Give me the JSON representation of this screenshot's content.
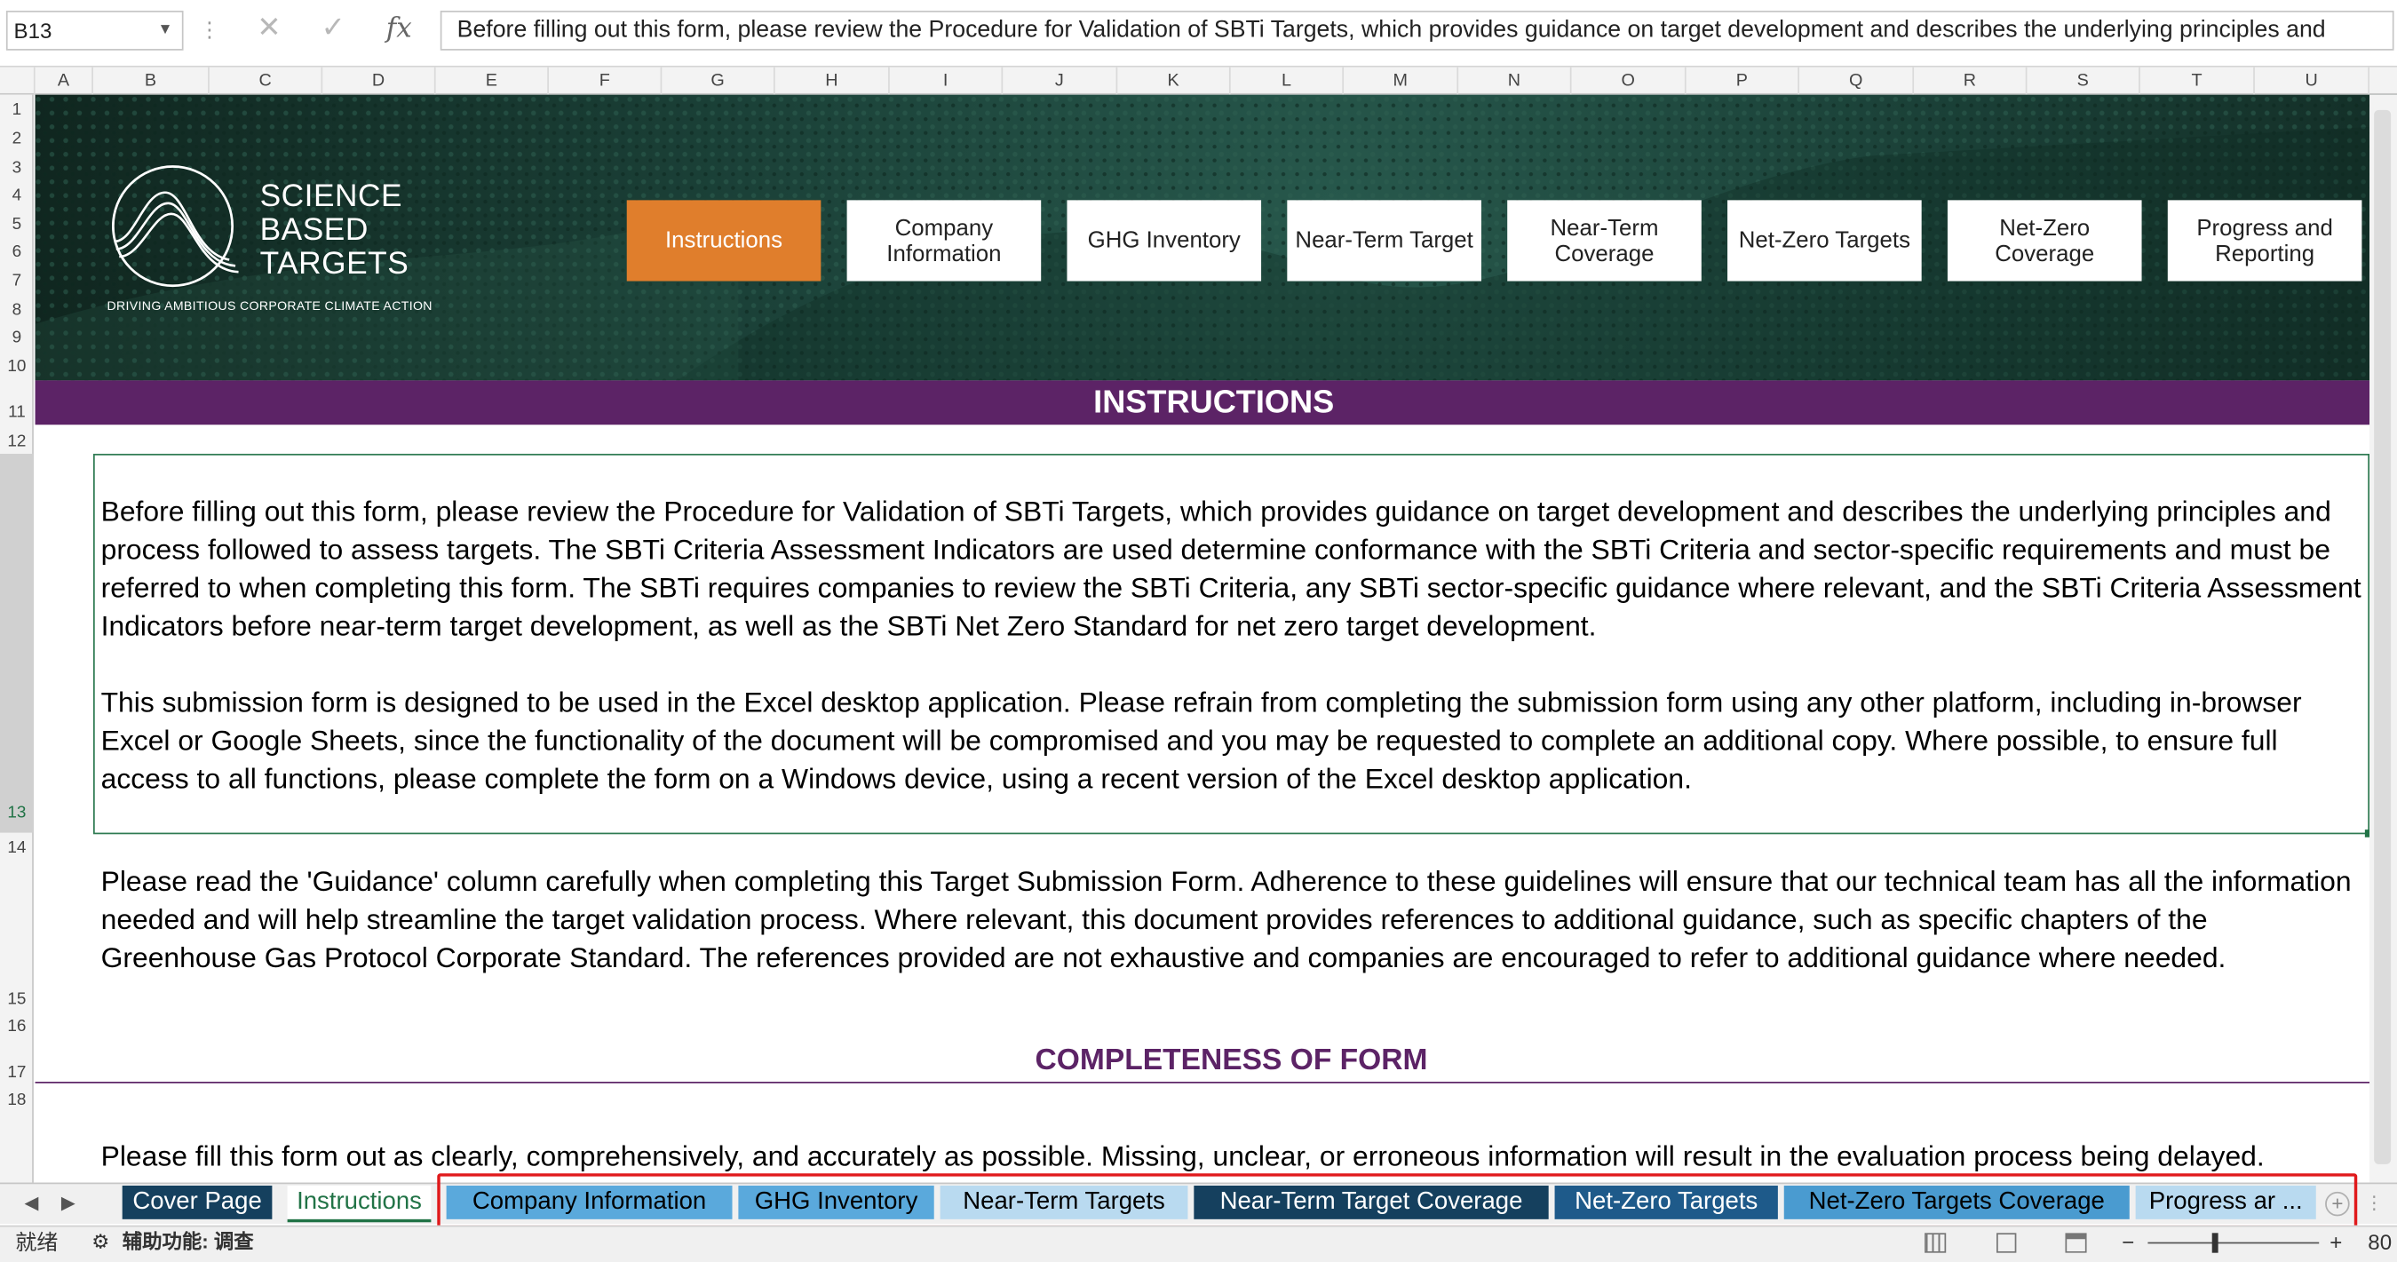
{
  "formula_bar": {
    "cell_ref": "B13",
    "cancel_symbol": "✕",
    "confirm_symbol": "✓",
    "fx_label": "fx",
    "content": "Before filling out this form, please review the Procedure for Validation of SBTi Targets, which provides guidance on target development and describes the underlying principles and"
  },
  "columns": [
    "A",
    "B",
    "C",
    "D",
    "E",
    "F",
    "G",
    "H",
    "I",
    "J",
    "K",
    "L",
    "M",
    "N",
    "O",
    "P",
    "Q",
    "R",
    "S",
    "T",
    "U"
  ],
  "rows": [
    "1",
    "2",
    "3",
    "4",
    "5",
    "6",
    "7",
    "8",
    "9",
    "10",
    "11",
    "12",
    "13",
    "14",
    "15",
    "16",
    "17",
    "18"
  ],
  "logo": {
    "line1": "SCIENCE",
    "line2": "BASED",
    "line3": "TARGETS",
    "tagline": "DRIVING AMBITIOUS CORPORATE CLIMATE ACTION"
  },
  "nav_buttons": [
    {
      "label": "Instructions"
    },
    {
      "label": "Company Information"
    },
    {
      "label": "GHG Inventory"
    },
    {
      "label": "Near-Term Target"
    },
    {
      "label": "Near-Term Coverage"
    },
    {
      "label": "Net-Zero Targets"
    },
    {
      "label": "Net-Zero Coverage"
    },
    {
      "label": "Progress and Reporting"
    }
  ],
  "instructions_header": "INSTRUCTIONS",
  "paragraph1": "Before filling out this form, please review the Procedure for Validation of SBTi Targets, which provides guidance on target development and describes the underlying principles and process followed to assess targets. The SBTi Criteria Assessment Indicators are used determine conformance with the SBTi Criteria and sector-specific requirements and must be referred to when completing this form. The SBTi requires companies to review the SBTi Criteria, any SBTi sector-specific guidance where relevant, and the SBTi Criteria Assessment Indicators before near-term target development, as well as the SBTi Net Zero Standard for net zero target development.",
  "paragraph2": "This submission form is designed to be used in the Excel desktop application. Please refrain from completing the submission form using any other platform, including in-browser Excel or Google Sheets, since the functionality of the document will be compromised and you may be requested to complete an additional copy. Where possible, to ensure full access to all functions, please complete the form on a Windows device, using a recent version of the Excel desktop application.",
  "paragraph3": "Please read the 'Guidance' column carefully when completing this Target Submission Form. Adherence to these guidelines will ensure that our technical team has all the information needed and will help streamline the target validation process. Where relevant, this document provides references to additional guidance, such as specific chapters of the Greenhouse Gas Protocol Corporate Standard. The references provided are not exhaustive and companies are encouraged to refer to additional guidance where needed.",
  "completeness_header": "COMPLETENESS OF FORM",
  "paragraph4": "Please fill this form out as clearly, comprehensively, and accurately as possible. Missing, unclear, or erroneous information will result in the evaluation process being delayed.",
  "sheet_tabs": [
    {
      "label": "Cover Page"
    },
    {
      "label": "Instructions"
    },
    {
      "label": "Company Information"
    },
    {
      "label": "GHG Inventory"
    },
    {
      "label": "Near-Term Targets"
    },
    {
      "label": "Near-Term Target Coverage"
    },
    {
      "label": "Net-Zero Targets"
    },
    {
      "label": "Net-Zero Targets Coverage"
    },
    {
      "label": "Progress ar ..."
    }
  ],
  "status_bar": {
    "ready": "就绪",
    "accessibility": "辅助功能: 调查",
    "zoom_minus": "−",
    "zoom_plus": "+",
    "zoom": "80"
  },
  "colors": {
    "banner": "#1b4138",
    "nav_active": "#e07e2c",
    "instructions_bar": "#5c2366",
    "tab_light": "#5aa9dc",
    "tab_dark": "#15405e",
    "highlight": "#e0191b"
  }
}
